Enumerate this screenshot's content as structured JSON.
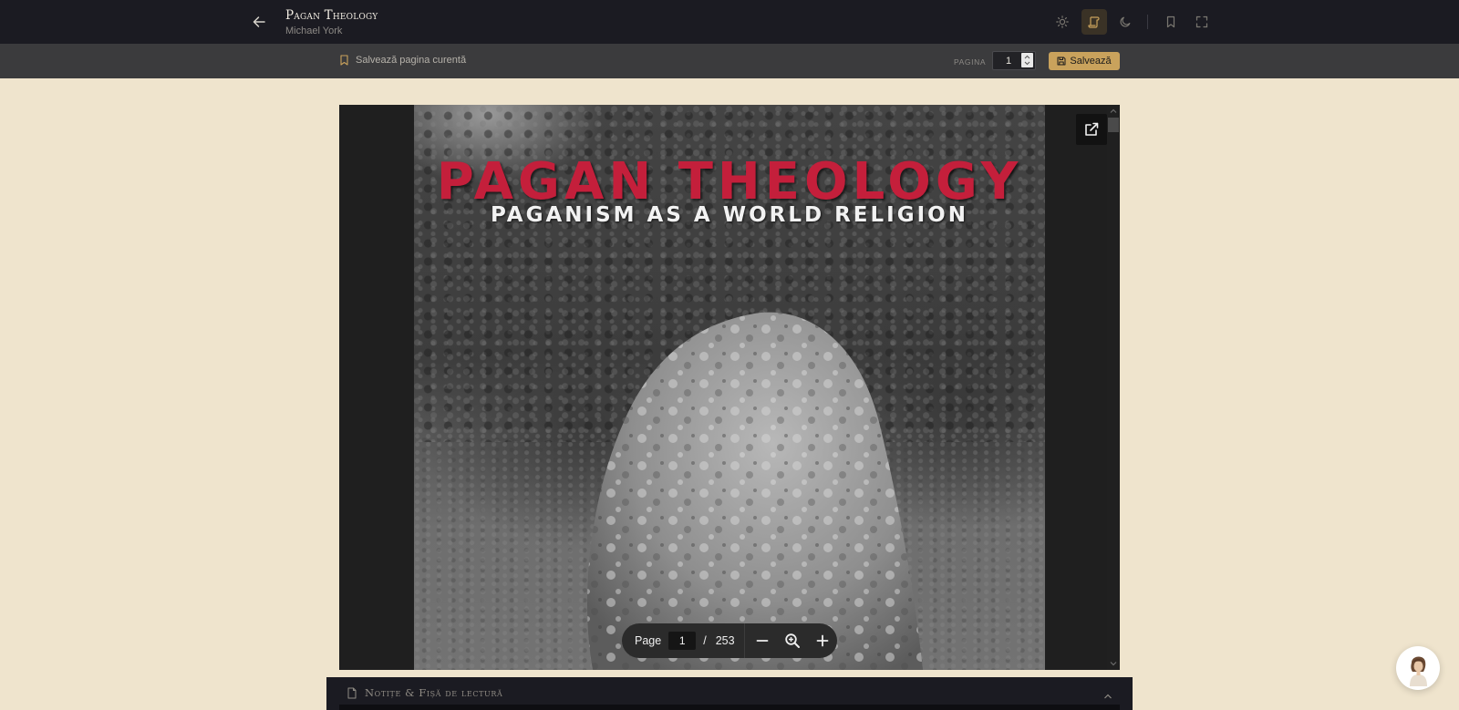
{
  "header": {
    "book_title": "Pagan Theology",
    "author": "Michael York",
    "icons": [
      "back-arrow-icon",
      "sun-icon",
      "scroll-icon",
      "moon-icon",
      "bookmark-icon",
      "fullscreen-icon"
    ],
    "active_mode": "scroll",
    "accent_color": "#c9a25c"
  },
  "subbar": {
    "save_current_label": "Salvează pagina curentă",
    "page_label": "PAGINA",
    "page_value": "1",
    "save_button_label": "Salvează"
  },
  "viewer": {
    "cover_title": "PAGAN THEOLOGY",
    "cover_subtitle": "PAGANISM AS A WORLD RELIGION",
    "toolbar": {
      "page_label": "Page",
      "current_page": "1",
      "separator": "/",
      "total_pages": "253"
    }
  },
  "notes": {
    "title": "Notițe & Fișă de lectură"
  }
}
